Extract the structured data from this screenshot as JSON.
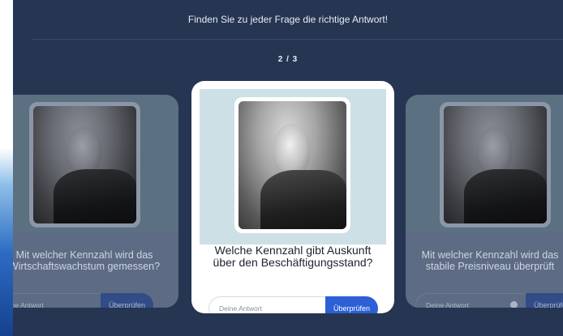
{
  "header": {
    "instruction": "Finden Sie zu jeder Frage die richtige Antwort!",
    "counter": "2 / 3"
  },
  "cards": [
    {
      "question": "Mit welcher Kennzahl wird das Wirtschaftswachstum gemessen?",
      "input_placeholder": "Deine Antwort",
      "button_label": "Überprüfen"
    },
    {
      "question": "Welche Kennzahl gibt Auskunft über den Beschäftigungsstand?",
      "input_placeholder": "Deine Antwort",
      "button_label": "Überprüfen"
    },
    {
      "question": "Mit welcher Kennzahl wird das stabile Preisniveau überprüft",
      "input_placeholder": "Deine Antwort",
      "button_label": "Überprüfen"
    }
  ],
  "icons": {
    "card_photo": "portrait-photo",
    "hint": "chat-bubble-icon"
  },
  "colors": {
    "background": "#253552",
    "accent": "#2d5fd6",
    "image_band": "#cde0e5"
  }
}
